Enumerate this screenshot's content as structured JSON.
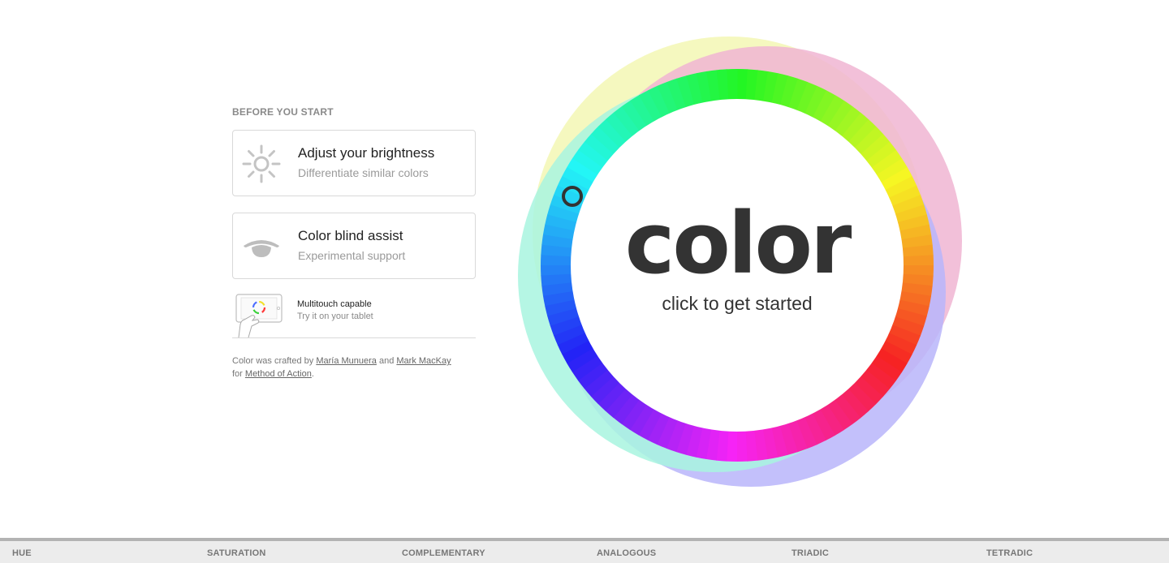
{
  "before_start": {
    "title": "BEFORE YOU START",
    "cards": [
      {
        "title": "Adjust your brightness",
        "subtitle": "Differentiate similar colors",
        "icon": "sun-icon"
      },
      {
        "title": "Color blind assist",
        "subtitle": "Experimental support",
        "icon": "eye-icon"
      }
    ],
    "multitouch": {
      "title": "Multitouch capable",
      "subtitle": "Try it on your tablet",
      "icon": "tablet-icon"
    },
    "credits": {
      "prefix": "Color was crafted by ",
      "author1": "María Munuera",
      "and": " and ",
      "author2": "Mark MacKay",
      "for": "for ",
      "company": "Method of Action",
      "suffix": "."
    }
  },
  "wheel": {
    "word": "color",
    "cta": "click to get started",
    "halo_colors": [
      "#f3f7b4",
      "#f0b5d2",
      "#b9b5fa",
      "#a8f4df"
    ],
    "ring_hue_start": 120,
    "marker": "ring-marker-icon"
  },
  "bottom_nav": {
    "tabs": [
      "HUE",
      "SATURATION",
      "COMPLEMENTARY",
      "ANALOGOUS",
      "TRIADIC",
      "TETRADIC"
    ]
  },
  "colors": {
    "background": "#ffffff",
    "text_dark": "#333333",
    "muted": "#9a9a9a",
    "bar_bg": "#ececec",
    "bar_border": "#b3b3b3"
  }
}
